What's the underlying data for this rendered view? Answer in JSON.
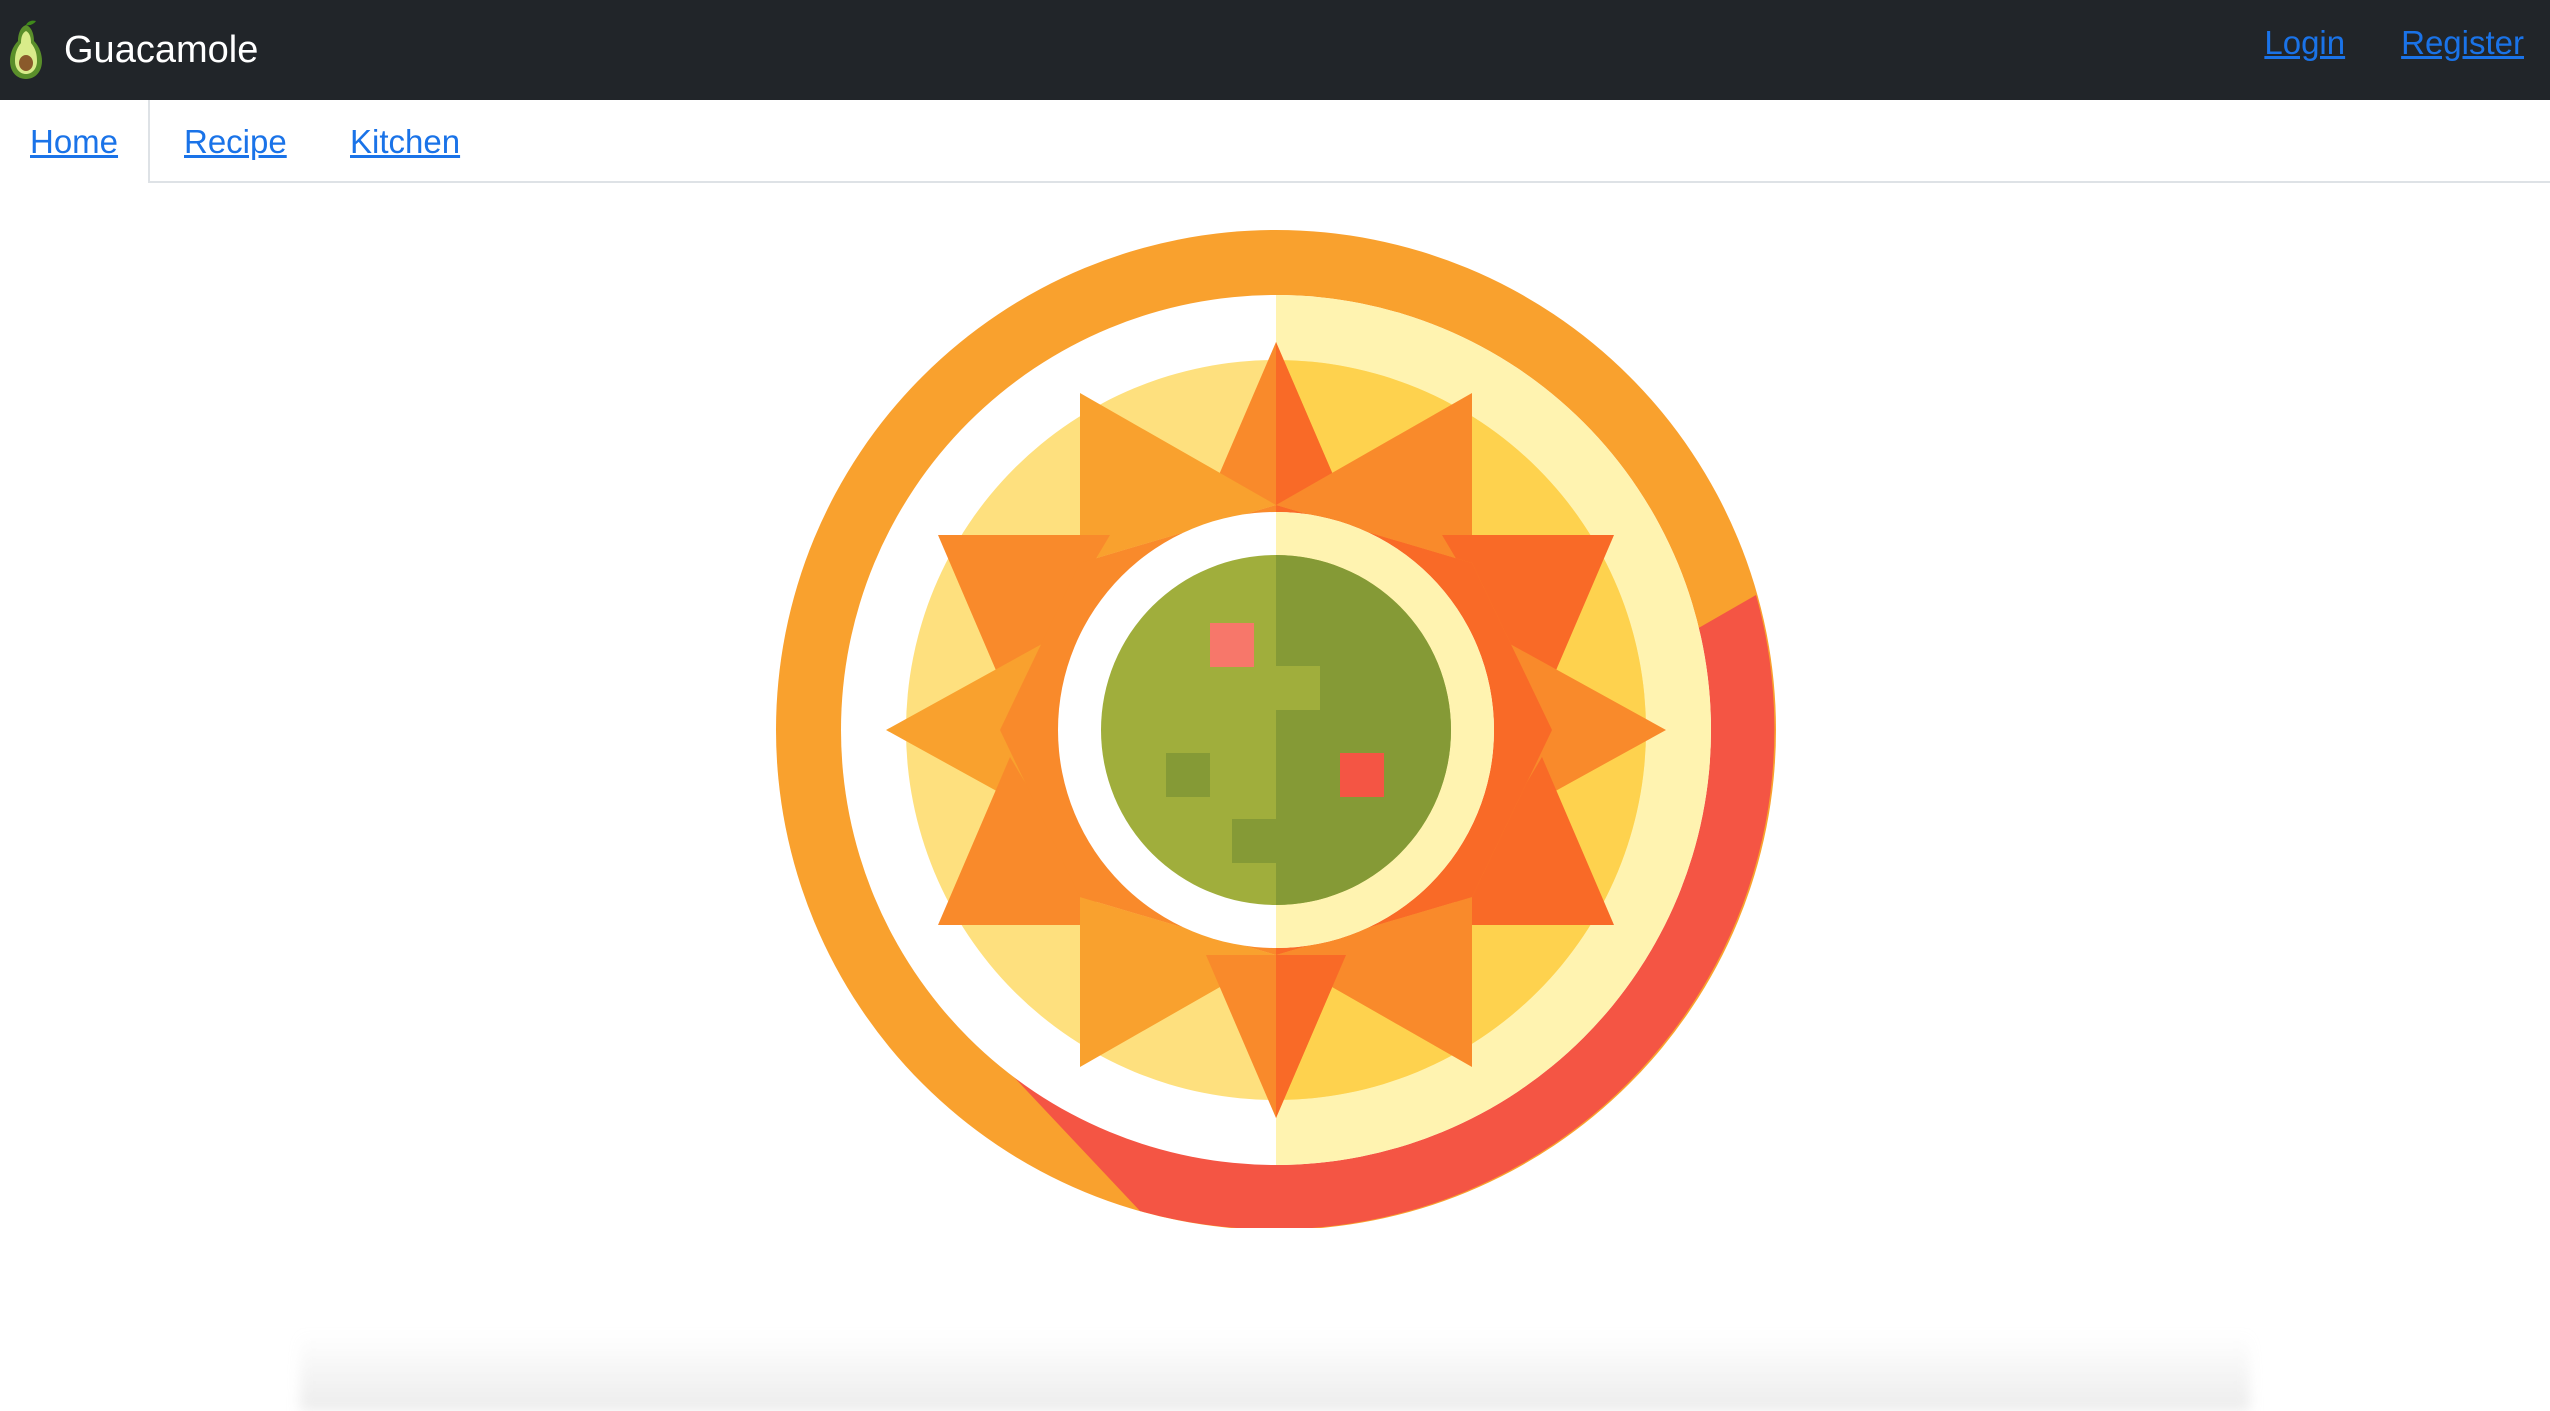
{
  "navbar": {
    "brand_name": "Guacamole",
    "brand_icon": "avocado-icon",
    "login_label": "Login",
    "register_label": "Register"
  },
  "tabs": [
    {
      "label": "Home",
      "active": true
    },
    {
      "label": "Recipe",
      "active": false
    },
    {
      "label": "Kitchen",
      "active": false
    }
  ],
  "hero": {
    "image": "guacamole-bowl-illustration"
  },
  "colors": {
    "navbar_bg": "#212529",
    "link": "#1a73e8",
    "bowl_orange": "#F9A12E",
    "bowl_red": "#F45544",
    "guac_light": "#A0AE3C",
    "guac_dark": "#859A36"
  }
}
